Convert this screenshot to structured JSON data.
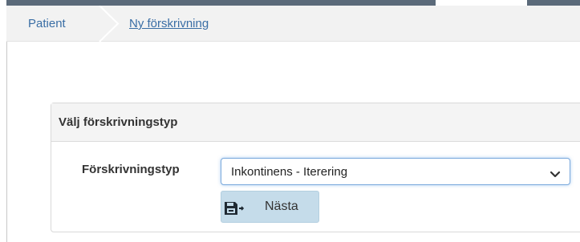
{
  "breadcrumb": {
    "root": "Patient",
    "current": "Ny förskrivning"
  },
  "panel": {
    "title": "Välj förskrivningstyp",
    "field_label": "Förskrivningstyp",
    "select_value": "Inkontinens - Iterering",
    "next_button_label": "Nästa"
  },
  "icons": {
    "separator": "chevron-right-icon",
    "select": "chevron-down-icon",
    "next": "save-arrow-icon"
  },
  "colors": {
    "link": "#3a6ea5",
    "button_bg": "#c5dcea",
    "topbar": "#5b6a7a"
  }
}
